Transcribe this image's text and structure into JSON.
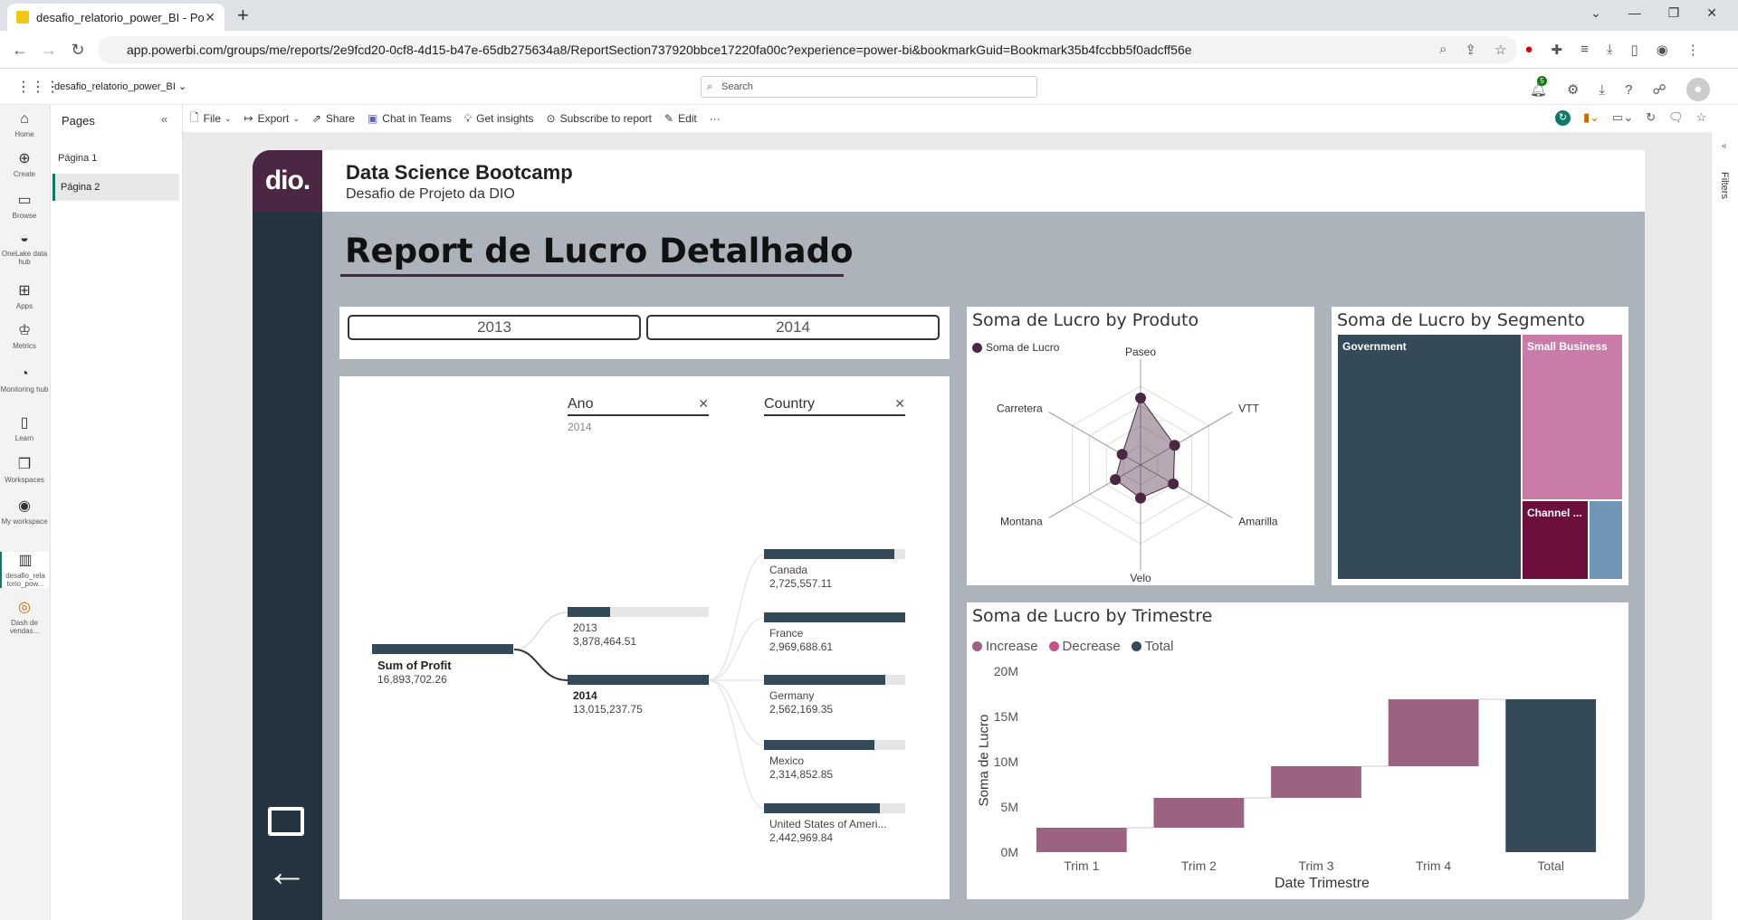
{
  "browser": {
    "tab_title": "desafio_relatorio_power_BI - Pow",
    "new_tab": "+",
    "url": "app.powerbi.com/groups/me/reports/2e9fcd20-0cf8-4d15-b47e-65db275634a8/ReportSection737920bbce17220fa00c?experience=power-bi&bookmarkGuid=Bookmark35b4fccbb5f0adcff56e"
  },
  "pbi": {
    "report_name": "desafio_relatorio_power_BI",
    "search_placeholder": "Search",
    "notification_count": "5"
  },
  "leftnav": [
    {
      "label": "Home",
      "icon": "home-icon"
    },
    {
      "label": "Create",
      "icon": "create-icon"
    },
    {
      "label": "Browse",
      "icon": "browse-icon"
    },
    {
      "label": "OneLake data hub",
      "icon": "onelake-icon"
    },
    {
      "label": "Apps",
      "icon": "apps-icon"
    },
    {
      "label": "Metrics",
      "icon": "metrics-icon"
    },
    {
      "label": "Monitoring hub",
      "icon": "monitoring-icon"
    },
    {
      "label": "Learn",
      "icon": "learn-icon"
    },
    {
      "label": "Workspaces",
      "icon": "workspaces-icon"
    },
    {
      "label": "My workspace",
      "icon": "my-workspace-icon"
    },
    {
      "label": "desafio_rela torio_pow...",
      "icon": "report-icon"
    },
    {
      "label": "Dash de vendas...",
      "icon": "dashboard-icon"
    }
  ],
  "pages": {
    "title": "Pages",
    "items": [
      "Página 1",
      "Página 2"
    ],
    "active": "Página 2"
  },
  "toolbar": {
    "file": "File",
    "export": "Export",
    "share": "Share",
    "chat": "Chat in Teams",
    "insights": "Get insights",
    "subscribe": "Subscribe to report",
    "edit": "Edit",
    "more": "···"
  },
  "filters_label": "Filters",
  "report": {
    "logo": "dio.",
    "header_title": "Data Science Bootcamp",
    "header_subtitle": "Desafio de Projeto da DIO",
    "main_title": "Report de Lucro Detalhado",
    "year_buttons": [
      "2013",
      "2014"
    ]
  },
  "decomp": {
    "col1_header": "Ano",
    "col1_selected": "2014",
    "col2_header": "Country",
    "root_label": "Sum of Profit",
    "root_value": "16,893,702.26",
    "years": [
      {
        "label": "2013",
        "value": "3,878,464.51",
        "fill": 0.3
      },
      {
        "label": "2014",
        "value": "13,015,237.75",
        "fill": 1.0
      }
    ],
    "countries": [
      {
        "label": "Canada",
        "value": "2,725,557.11",
        "fill": 0.92
      },
      {
        "label": "France",
        "value": "2,969,688.61",
        "fill": 1.0
      },
      {
        "label": "Germany",
        "value": "2,562,169.35",
        "fill": 0.86
      },
      {
        "label": "Mexico",
        "value": "2,314,852.85",
        "fill": 0.78
      },
      {
        "label": "United States of Ameri...",
        "value": "2,442,969.84",
        "fill": 0.82
      }
    ]
  },
  "radar": {
    "title": "Soma de Lucro by Produto",
    "legend": "Soma de Lucro",
    "color": "#4c2743",
    "chart_data": {
      "type": "radar",
      "categories": [
        "Paseo",
        "VTT",
        "Amarilla",
        "Velo",
        "Montana",
        "Carretera"
      ],
      "values": [
        0.85,
        0.5,
        0.48,
        0.42,
        0.37,
        0.27
      ]
    }
  },
  "treemap": {
    "title": "Soma de Lucro by Segmento",
    "items": [
      {
        "label": "Government",
        "color": "#344a58"
      },
      {
        "label": "Small Business",
        "color": "#c97ca8"
      },
      {
        "label": "Channel ...",
        "color": "#6c0f3c"
      },
      {
        "label": "",
        "color": "#6f96b8"
      }
    ]
  },
  "waterfall": {
    "title": "Soma de Lucro by Trimestre",
    "legend": [
      {
        "label": "Increase",
        "color": "#9c6282"
      },
      {
        "label": "Decrease",
        "color": "#c8508a"
      },
      {
        "label": "Total",
        "color": "#344a58"
      }
    ],
    "ylabel": "Soma de Lucro",
    "xlabel": "Date Trimestre",
    "yticks": [
      "20M",
      "15M",
      "10M",
      "5M",
      "0M"
    ],
    "chart_data": {
      "type": "waterfall",
      "categories": [
        "Trim 1",
        "Trim 2",
        "Trim 3",
        "Trim 4",
        "Total"
      ],
      "values": [
        2.7,
        3.3,
        3.5,
        7.4,
        16.9
      ],
      "ylim": [
        0,
        20
      ]
    }
  }
}
